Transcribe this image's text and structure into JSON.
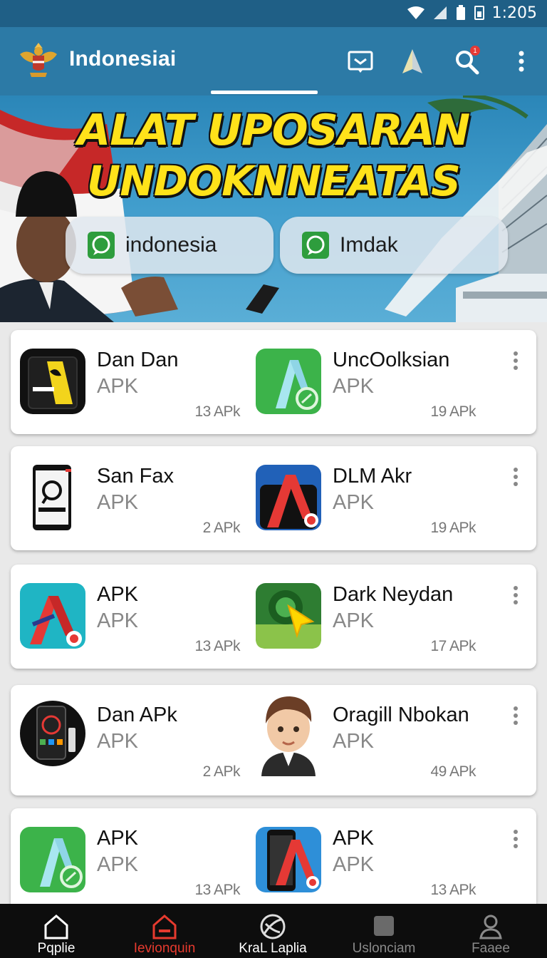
{
  "status_bar": {
    "time": "1:205"
  },
  "app_bar": {
    "title": "Indonesiai",
    "actions": [
      "message-icon",
      "navigate-icon",
      "search-icon",
      "more-vert-icon"
    ],
    "search_badge": "1"
  },
  "banner": {
    "headline_line1": "ALAT UPOSARAN",
    "headline_line2": "UNDOKNNEATAS",
    "chips": [
      {
        "label": "indonesia",
        "icon": "chat-icon"
      },
      {
        "label": "Imdak",
        "icon": "chat-icon"
      }
    ]
  },
  "cards": [
    {
      "items": [
        {
          "name": "Dan Dan",
          "type": "APK",
          "size": "13 APk",
          "icon": "phone-dark-icon"
        },
        {
          "name": "UncOolksian",
          "type": "APK",
          "size": "19 APk",
          "icon": "app-green-a-icon"
        }
      ]
    },
    {
      "items": [
        {
          "name": "San Fax",
          "type": "APK",
          "size": "2 APk",
          "icon": "phone-white-icon"
        },
        {
          "name": "DLM Akr",
          "type": "APK",
          "size": "19 APk",
          "icon": "app-blue-a-icon"
        }
      ]
    },
    {
      "items": [
        {
          "name": "APK",
          "type": "APK",
          "size": "13 APk",
          "icon": "app-teal-a-icon"
        },
        {
          "name": "Dark Neydan",
          "type": "APK",
          "size": "17 APk",
          "icon": "app-green-cursor-icon"
        }
      ]
    },
    {
      "items": [
        {
          "name": "Dan APk",
          "type": "APK",
          "size": "2 APk",
          "icon": "phone-round-icon"
        },
        {
          "name": "Oragill Nbokan",
          "type": "APK",
          "size": "49 APk",
          "icon": "avatar-icon"
        }
      ]
    },
    {
      "items": [
        {
          "name": "APK",
          "type": "APK",
          "size": "13 APk",
          "icon": "app-green-a-icon"
        },
        {
          "name": "APK",
          "type": "APK",
          "size": "13 APk",
          "icon": "app-blue-phone-icon"
        }
      ]
    }
  ],
  "bottom_nav": [
    {
      "label": "Pqplie",
      "icon": "home-icon",
      "active": false
    },
    {
      "label": "Ievionquin",
      "icon": "store-icon",
      "active": true
    },
    {
      "label": "KraL Laplia",
      "icon": "globe-icon",
      "active": false
    },
    {
      "label": "Uslonciam",
      "icon": "square-icon",
      "active": false
    },
    {
      "label": "Faaee",
      "icon": "profile-icon",
      "active": false
    }
  ],
  "colors": {
    "status_bar": "#1f5f86",
    "app_bar": "#2c7aa6",
    "headline": "#ffe21a",
    "nav_active": "#e63a2e",
    "nav_bg": "#0d0d0d"
  }
}
